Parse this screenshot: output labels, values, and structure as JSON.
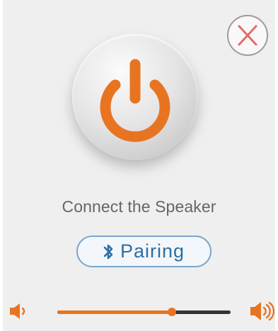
{
  "main": {
    "connect_label": "Connect the Speaker",
    "pairing_label": "Pairing"
  },
  "volume": {
    "level": 0.66
  },
  "colors": {
    "accent": "#e87422",
    "pairing": "#2f6f9f"
  },
  "icons": {
    "close": "close-icon",
    "power": "power-icon",
    "bluetooth": "bluetooth-icon",
    "volume_low": "volume-low-icon",
    "volume_high": "volume-high-icon"
  }
}
